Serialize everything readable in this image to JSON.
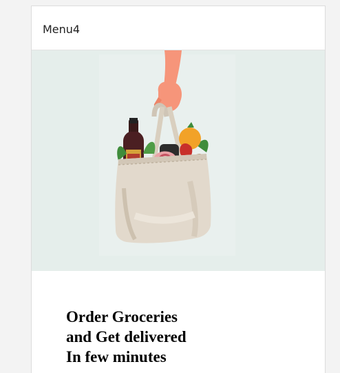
{
  "header": {
    "title": "Menu4"
  },
  "hero": {
    "illustration": "hand-holding-grocery-bag",
    "background_color": "#e5eeeb"
  },
  "content": {
    "tagline_lines": [
      "Order Groceries",
      "and Get delivered",
      "In few minutes"
    ]
  },
  "colors": {
    "page_background": "#f3f3f3",
    "card_background": "#ffffff",
    "bag": "#e2d9cc",
    "skin": "#f6957a"
  }
}
